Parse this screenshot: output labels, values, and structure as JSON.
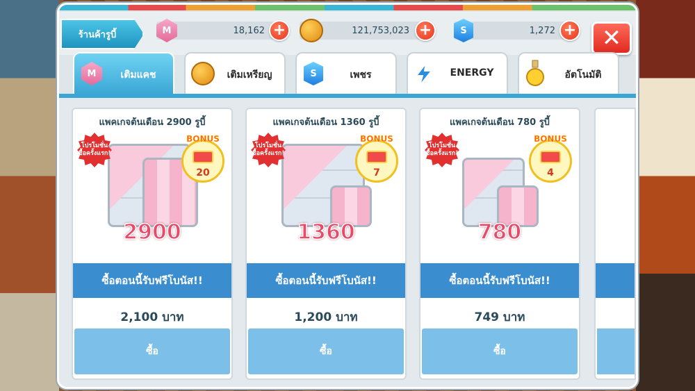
{
  "header": {
    "shop_label": "ร้านค้ารูบี้",
    "currencies": [
      {
        "icon": "ruby-m-icon",
        "letter": "M",
        "value": "18,162"
      },
      {
        "icon": "gold-coin-icon",
        "letter": "",
        "value": "121,753,023"
      },
      {
        "icon": "blue-gem-s-icon",
        "letter": "S",
        "value": "1,272"
      }
    ],
    "plus": "+",
    "close": "✕"
  },
  "tabs": [
    {
      "label": "เติมแคช",
      "icon": "ruby-m-icon",
      "letter": "M",
      "active": true
    },
    {
      "label": "เติมเหรียญ",
      "icon": "gold-coin-icon",
      "letter": "",
      "active": false
    },
    {
      "label": "เพชร",
      "icon": "blue-gem-s-icon",
      "letter": "S",
      "active": false
    },
    {
      "label": "ENERGY",
      "icon": "energy-icon",
      "letter": "",
      "active": false
    },
    {
      "label": "อัตโนมัติ",
      "icon": "potion-icon",
      "letter": "",
      "active": false
    }
  ],
  "packages": [
    {
      "title": "แพคเกจต้นเดือน 2900 รูบี้",
      "promo": "โปรโมชั่น ซื้อครั้งแรก!",
      "bonus_label": "BONUS",
      "bonus": "20",
      "amount": "2900",
      "buy_now": "ซื้อตอนนี้รับฟรีโบนัส!!",
      "price": "2,100 บาท",
      "buy": "ซื้อ"
    },
    {
      "title": "แพคเกจต้นเดือน 1360 รูบี้",
      "promo": "โปรโมชั่น ซื้อครั้งแรก!",
      "bonus_label": "BONUS",
      "bonus": "7",
      "amount": "1360",
      "buy_now": "ซื้อตอนนี้รับฟรีโบนัส!!",
      "price": "1,200 บาท",
      "buy": "ซื้อ"
    },
    {
      "title": "แพคเกจต้นเดือน 780 รูบี้",
      "promo": "โปรโมชั่น ซื้อครั้งแรก!",
      "bonus_label": "BONUS",
      "bonus": "4",
      "amount": "780",
      "buy_now": "ซื้อตอนนี้รับฟรีโบนัส!!",
      "price": "749 บาท",
      "buy": "ซื้อ"
    }
  ],
  "colors": {
    "accent": "#3aa6d6",
    "buy_now_bg": "#3a8ed0",
    "buy_btn_bg": "#7cc0ea",
    "close_bg": "#e02a20",
    "ruby": "#e84a6a"
  }
}
